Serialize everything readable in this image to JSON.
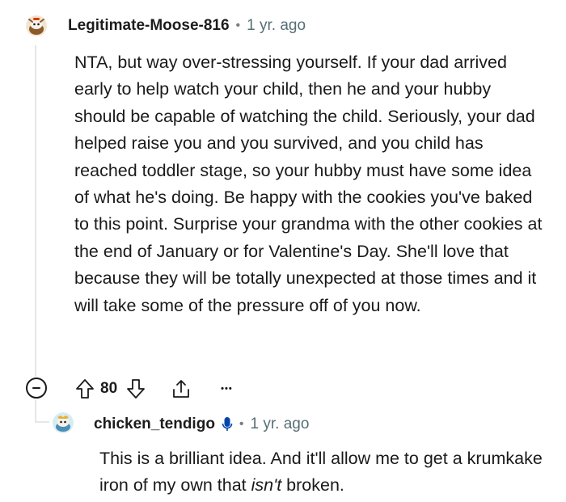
{
  "comment": {
    "author": "Legitimate-Moose-816",
    "separator": "•",
    "age": "1 yr. ago",
    "body": "NTA, but way over-stressing yourself. If your dad arrived early to help watch your child, then he and your hubby should be capable of watching the child. Seriously, your dad helped raise you and you survived, and you child has reached toddler stage, so your hubby must have some idea of what he's doing. Be happy with the cookies you've baked to this point. Surprise your grandma with the other cookies at the end of January or for Valentine's Day. She'll love that because they will be totally unexpected at those times and it will take some of the pressure off of you now.",
    "score": "80",
    "more_label": "•••"
  },
  "reply": {
    "author": "chicken_tendigo",
    "separator": "•",
    "age": "1 yr. ago",
    "body_before": "This is a brilliant idea. And it'll allow me to get a krumkake iron of my own that ",
    "body_emphasis": "isn't",
    "body_after": " broken."
  },
  "icons": {
    "collapse": "collapse-minus-icon",
    "upvote": "upvote-arrow-icon",
    "downvote": "downvote-arrow-icon",
    "share": "share-icon",
    "more": "more-options-icon",
    "mic": "microphone-icon"
  },
  "colors": {
    "text": "#1a1a1b",
    "meta": "#576f76",
    "mic": "#0045ac",
    "thread": "#e5e7ea"
  }
}
